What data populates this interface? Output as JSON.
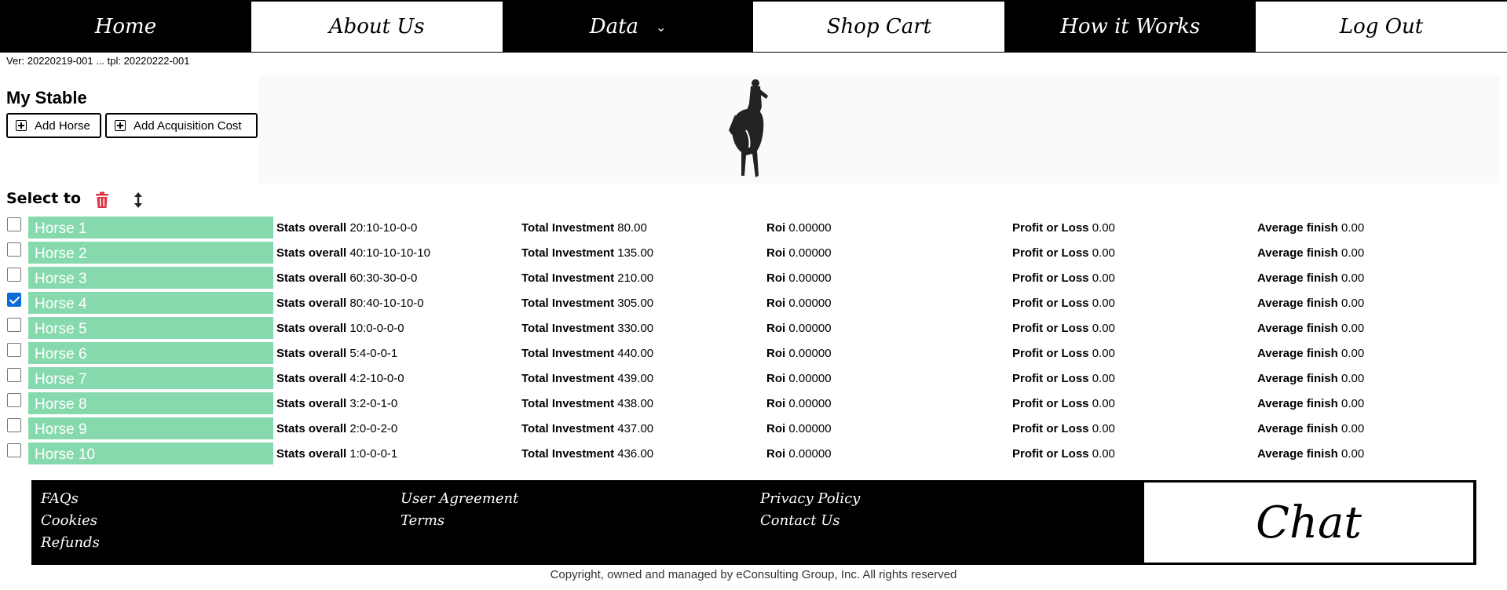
{
  "nav": {
    "home": "Home",
    "about": "About Us",
    "data": "Data",
    "shop": "Shop Cart",
    "how": "How it Works",
    "logout": "Log Out"
  },
  "version": "Ver: 20220219-001 ... tpl: 20220222-001",
  "page_title": "My Stable",
  "buttons": {
    "add_horse": "Add Horse",
    "add_acquisition": "Add Acquisition Cost"
  },
  "select_to": "Select to",
  "labels": {
    "stats": "Stats overall",
    "investment": "Total Investment",
    "roi": "Roi",
    "pl": "Profit or Loss",
    "avg": "Average finish"
  },
  "horses": [
    {
      "name": "Horse 1",
      "checked": false,
      "stats": "20:10-10-0-0",
      "investment": "80.00",
      "roi": "0.00000",
      "pl": "0.00",
      "avg": "0.00"
    },
    {
      "name": "Horse 2",
      "checked": false,
      "stats": "40:10-10-10-10",
      "investment": "135.00",
      "roi": "0.00000",
      "pl": "0.00",
      "avg": "0.00"
    },
    {
      "name": "Horse 3",
      "checked": false,
      "stats": "60:30-30-0-0",
      "investment": "210.00",
      "roi": "0.00000",
      "pl": "0.00",
      "avg": "0.00"
    },
    {
      "name": "Horse 4",
      "checked": true,
      "stats": "80:40-10-10-0",
      "investment": "305.00",
      "roi": "0.00000",
      "pl": "0.00",
      "avg": "0.00"
    },
    {
      "name": "Horse 5",
      "checked": false,
      "stats": "10:0-0-0-0",
      "investment": "330.00",
      "roi": "0.00000",
      "pl": "0.00",
      "avg": "0.00"
    },
    {
      "name": "Horse 6",
      "checked": false,
      "stats": "5:4-0-0-1",
      "investment": "440.00",
      "roi": "0.00000",
      "pl": "0.00",
      "avg": "0.00"
    },
    {
      "name": "Horse 7",
      "checked": false,
      "stats": "4:2-10-0-0",
      "investment": "439.00",
      "roi": "0.00000",
      "pl": "0.00",
      "avg": "0.00"
    },
    {
      "name": "Horse 8",
      "checked": false,
      "stats": "3:2-0-1-0",
      "investment": "438.00",
      "roi": "0.00000",
      "pl": "0.00",
      "avg": "0.00"
    },
    {
      "name": "Horse 9",
      "checked": false,
      "stats": "2:0-0-2-0",
      "investment": "437.00",
      "roi": "0.00000",
      "pl": "0.00",
      "avg": "0.00"
    },
    {
      "name": "Horse 10",
      "checked": false,
      "stats": "1:0-0-0-1",
      "investment": "436.00",
      "roi": "0.00000",
      "pl": "0.00",
      "avg": "0.00"
    }
  ],
  "footer": {
    "faqs": "FAQs",
    "cookies": "Cookies",
    "refunds": "Refunds",
    "user_agreement": "User Agreement",
    "terms": "Terms",
    "privacy": "Privacy Policy",
    "contact": "Contact Us",
    "chat": "Chat"
  },
  "copyright": "Copyright, owned and managed by eConsulting Group, Inc. All rights reserved",
  "colors": {
    "horse_bg": "#86d9ad",
    "delete_red": "#dc3545",
    "checkbox_blue": "#0b6cd8"
  },
  "icons": {
    "delete": "trash-icon",
    "sort": "sort-arrows-icon",
    "add": "plus-square-icon",
    "dropdown": "chevron-down-icon"
  }
}
